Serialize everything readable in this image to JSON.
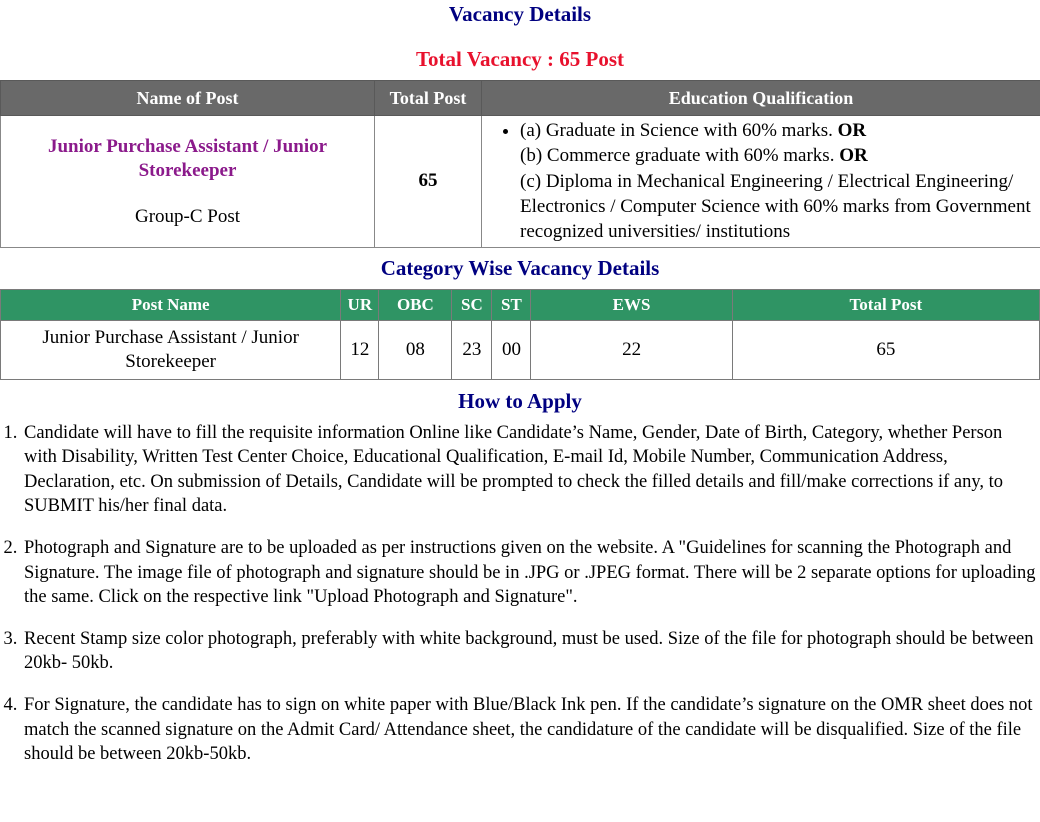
{
  "headings": {
    "vacancy_details": "Vacancy Details",
    "total_vacancy": "Total Vacancy : 65 Post",
    "category_wise": "Category Wise Vacancy Details",
    "how_to_apply": "How to Apply"
  },
  "colors": {
    "heading_navy": "#000080",
    "heading_red": "#e8112d",
    "table1_header_bg": "#696969",
    "table2_header_bg": "#2f9464",
    "post_name_purple": "#8b1a8b"
  },
  "vacancy_table": {
    "headers": {
      "name_of_post": "Name of Post",
      "total_post": "Total Post",
      "education_qualification": "Education Qualification"
    },
    "row": {
      "post_name": "Junior Purchase Assistant / Junior Storekeeper",
      "post_group": "Group-C Post",
      "total_post": "65",
      "education_items": [
        "(a) Graduate in Science with 60% marks. OR (b) Commerce graduate with 60% marks. OR (c) Diploma in Mechanical Engineering / Electrical Engineering/ Electronics / Computer Science with 60% marks from Government recognized universities/ institutions"
      ],
      "education_lines": [
        "(a) Graduate in Science with 60% marks. ",
        "OR",
        "(b) Commerce graduate with 60% marks. ",
        "OR",
        "(c) Diploma in Mechanical Engineering / Electrical Engineering/ Electronics / Computer Science with 60% marks from Government recognized universities/ institutions"
      ]
    }
  },
  "category_table": {
    "headers": [
      "Post Name",
      "UR",
      "OBC",
      "SC",
      "ST",
      "EWS",
      "Total Post"
    ],
    "rows": [
      {
        "post_name": "Junior Purchase Assistant / Junior Storekeeper",
        "ur": "12",
        "obc": "08",
        "sc": "23",
        "st": "00",
        "ews": "22",
        "total": "65"
      }
    ]
  },
  "how_to_apply": {
    "items": [
      "Candidate will have to fill the requisite information Online like Candidate’s Name, Gender, Date of Birth, Category, whether Person with Disability, Written Test Center Choice, Educational Qualification, E-mail Id, Mobile Number, Communication Address, Declaration, etc. On submission of Details, Candidate will be prompted to check the filled details and fill/make corrections if any, to SUBMIT his/her final data.",
      "Photograph and Signature are to be uploaded as per instructions given on the website. A \"Guidelines for scanning the Photograph and Signature. The image file of photograph and signature should be in .JPG or .JPEG format. There will be 2 separate options for uploading the same. Click on the respective link \"Upload Photograph and Signature\".",
      "Recent Stamp size color photograph, preferably with white background, must be used. Size of the file for photograph should be between 20kb- 50kb.",
      "For Signature, the candidate has to sign on white paper with Blue/Black Ink pen. If the candidate’s signature on the OMR sheet does not match the scanned signature on the Admit Card/ Attendance sheet, the candidature of the candidate will be disqualified. Size of the file should be between 20kb-50kb."
    ]
  }
}
